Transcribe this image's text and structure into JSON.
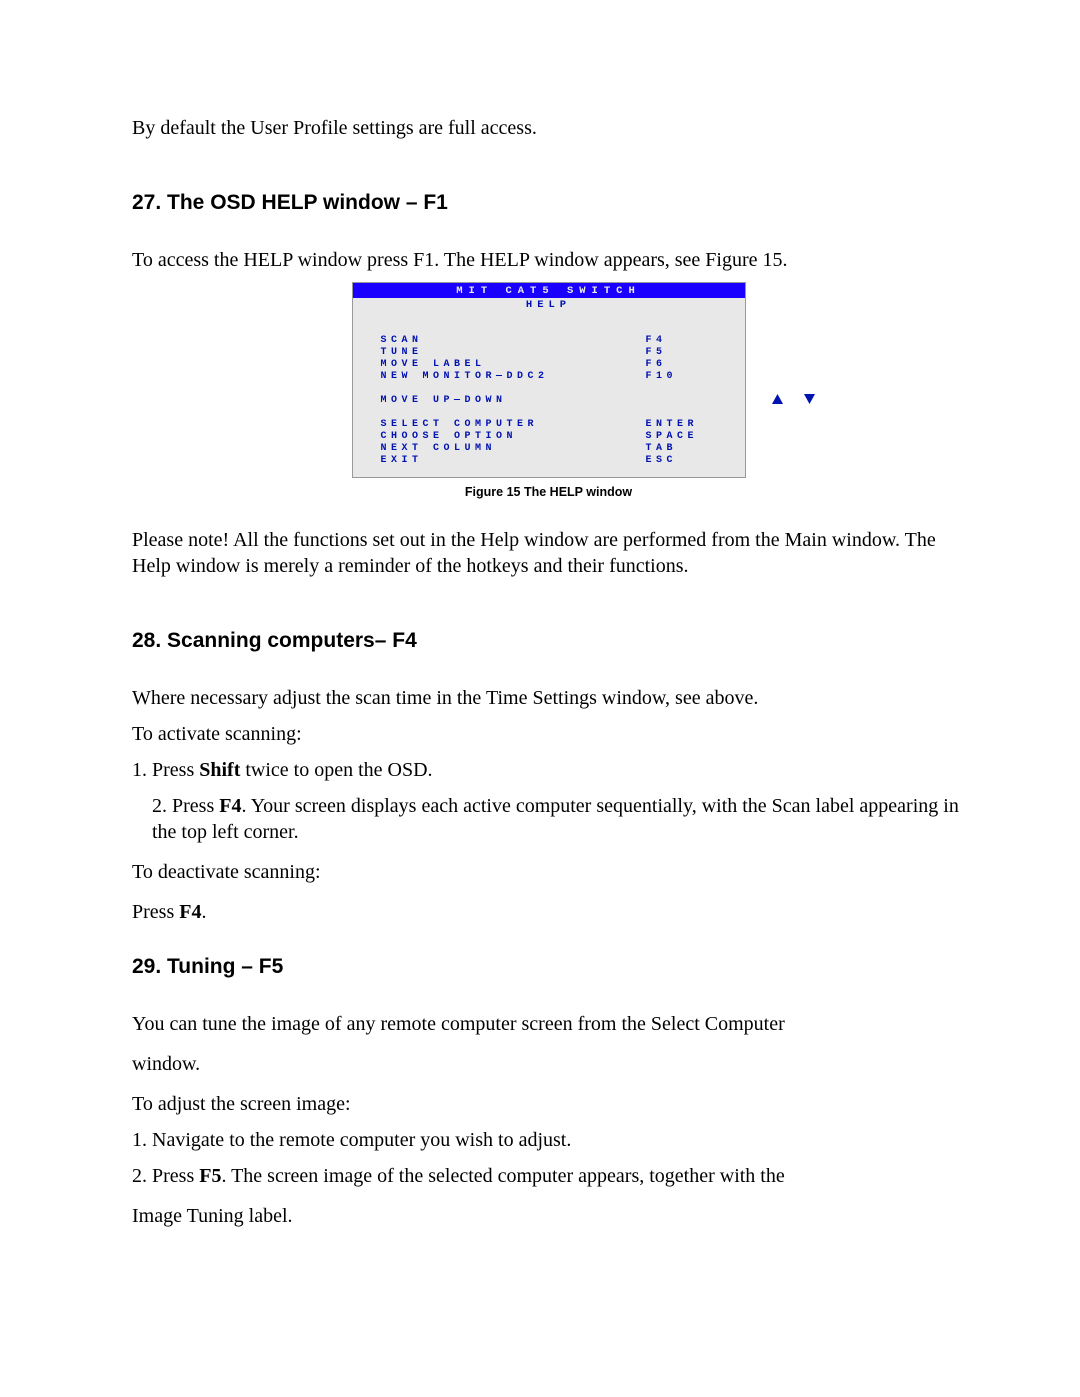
{
  "intro": "By default the User Profile settings are full access.",
  "section27": {
    "title": "27. The OSD HELP window – F1",
    "p1": "To access the HELP window press F1. The HELP window appears, see Figure 15.",
    "p2": "Please note! All the functions set out in the Help window are performed from the Main window. The Help window is merely a reminder of the hotkeys and their functions."
  },
  "figure15": {
    "caption": "Figure 15 The HELP window",
    "window_title": "MIT CAT5 SWITCH",
    "window_subtitle": "HELP",
    "rows": [
      {
        "label": "SCAN",
        "key": "F4"
      },
      {
        "label": "TUNE",
        "key": "F5"
      },
      {
        "label": "MOVE LABEL",
        "key": "F6"
      },
      {
        "label": "NEW MONITOR—DDC2",
        "key": "F10"
      },
      {
        "label": "MOVE UP—DOWN",
        "key": "ARROWS"
      },
      {
        "label": "SELECT COMPUTER",
        "key": "ENTER"
      },
      {
        "label": "CHOOSE OPTION",
        "key": "SPACE"
      },
      {
        "label": "NEXT COLUMN",
        "key": "TAB"
      },
      {
        "label": "EXIT",
        "key": "ESC"
      }
    ]
  },
  "section28": {
    "title": "28. Scanning computers– F4",
    "p1": "Where necessary adjust the scan time in the Time Settings window, see above.",
    "p2": "To activate scanning:",
    "li1a": "1. Press ",
    "li1b": "Shift",
    "li1c": " twice to open the OSD.",
    "li2a": "2. Press ",
    "li2b": "F4",
    "li2c": ". Your screen displays each active computer sequentially, with the Scan label appearing in the top left corner.",
    "p4": "To deactivate scanning:",
    "p5a": "Press ",
    "p5b": "F4",
    "p5c": "."
  },
  "section29": {
    "title": "29. Tuning – F5",
    "p1": "You can tune the image of any remote computer screen from the Select Computer",
    "p2": "window.",
    "p3": "To adjust the screen image:",
    "li1": "1. Navigate to the remote computer you wish to adjust.",
    "li2a": "2. Press ",
    "li2b": "F5",
    "li2c": ". The screen image of the selected computer appears, together with the",
    "p4": "Image Tuning label."
  }
}
